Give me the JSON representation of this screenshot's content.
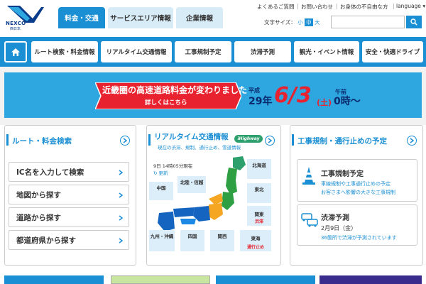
{
  "brand": {
    "name": "NEXCO",
    "sub": "西日本"
  },
  "header_tabs": [
    {
      "label": "料金・交通",
      "active": true
    },
    {
      "label": "サービスエリア情報",
      "active": false
    },
    {
      "label": "企業情報",
      "active": false
    }
  ],
  "util_links": [
    "よくあるご質問",
    "お問い合わせ",
    "お身体の不自由な方",
    "language"
  ],
  "font_size": {
    "label": "文字サイズ：",
    "small": "小",
    "medium": "中",
    "large": "大"
  },
  "search": {
    "placeholder": "",
    "icon": "search-icon"
  },
  "nav": {
    "home_icon": "home-icon",
    "items": [
      "ルート検索・料金情報",
      "リアルタイム交通情報",
      "工事規制予定",
      "渋滞予測",
      "観光・イベント情報",
      "安全・快適ドライブ"
    ]
  },
  "banner": {
    "line1": "近畿圏の高速道路料金が変わりました",
    "line2": "詳しくはこちら",
    "era": "平成",
    "year": "29年",
    "date": "6/3",
    "dow": "(土)",
    "am": "午前",
    "time": "0時～"
  },
  "route_card": {
    "title": "ルート・料金検索",
    "items": [
      "IC名を入力して検索",
      "地図から探す",
      "道路から探す",
      "都道府県から探す"
    ]
  },
  "traffic_card": {
    "title": "リアルタイム交通情報",
    "badge": "iHighway",
    "subtitle": "現在の渋滞、規制、通行止め、雪道情報",
    "time": "9日 14時05分現在",
    "update": "更新",
    "regions": {
      "hokkaido": "北海道",
      "tohoku": "東北",
      "kanto": "関東",
      "kanto_status": "渋滞",
      "tokai": "東海",
      "tokai_status": "通行止め",
      "hokuriku": "北陸・信越",
      "chugoku": "中国",
      "kyushu": "九州・沖縄",
      "shikoku": "四国",
      "kansai": "関西"
    },
    "colors": {
      "west": "#1565c0",
      "central": "#f5a623",
      "east": "#2ea043",
      "north": "#2ea06e"
    }
  },
  "construction_card": {
    "title": "工事規制・通行止めの予定",
    "items": [
      {
        "title": "工事規制予定",
        "desc1": "車線規制や工事通行止めの予定",
        "desc2": "お客さまへ影響の大きな工事規制",
        "icon": "traffic-cone-icon"
      },
      {
        "title": "渋滞予測",
        "date": "2月9日（金）",
        "desc1": "36箇所で渋滞が予測されています",
        "icon": "traffic-jam-icon"
      }
    ]
  }
}
